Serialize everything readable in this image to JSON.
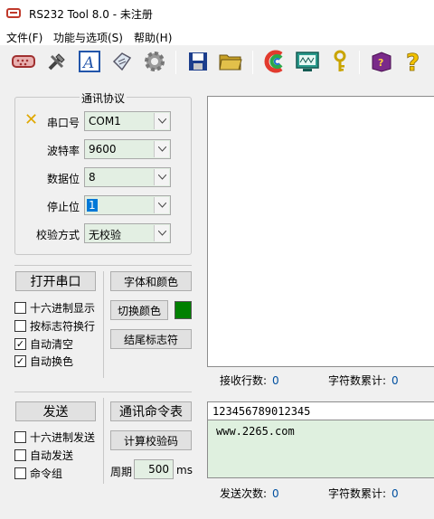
{
  "window": {
    "title": "RS232 Tool 8.0 - 未注册"
  },
  "menu": {
    "items": [
      "文件(F)",
      "功能与选项(S)",
      "帮助(H)"
    ]
  },
  "toolbar": {
    "icons": [
      "serial-port-icon",
      "tools-icon",
      "text-font-icon",
      "tag-icon",
      "gear-icon",
      "save-icon",
      "open-folder-icon",
      "color-icon",
      "monitor-icon",
      "key-icon",
      "book-icon",
      "help-icon"
    ]
  },
  "comm_settings": {
    "title": "通讯协议",
    "port": {
      "label": "串口号",
      "value": "COM1"
    },
    "baud": {
      "label": "波特率",
      "value": "9600"
    },
    "data_bits": {
      "label": "数据位",
      "value": "8"
    },
    "stop_bits": {
      "label": "停止位",
      "value": "1"
    },
    "parity": {
      "label": "校验方式",
      "value": "无校验"
    }
  },
  "receive_controls": {
    "open_port": "打开串口",
    "font_color": "字体和颜色",
    "switch_color": "切换颜色",
    "end_marker": "结尾标志符",
    "accent_color": "#008000",
    "hex_display": {
      "label": "十六进制显示",
      "checked": false
    },
    "wrap_by_marker": {
      "label": "按标志符换行",
      "checked": false
    },
    "auto_clear": {
      "label": "自动清空",
      "checked": true
    },
    "auto_color": {
      "label": "自动换色",
      "checked": true
    }
  },
  "receive_stats": {
    "rows_label": "接收行数:",
    "rows_value": "0",
    "chars_label": "字符数累计:",
    "chars_value": "0"
  },
  "send_controls": {
    "send": "发送",
    "cmd_table": "通讯命令表",
    "calc_checksum": "计算校验码",
    "hex_send": {
      "label": "十六进制发送",
      "checked": false
    },
    "auto_send": {
      "label": "自动发送",
      "checked": false
    },
    "cmd_group": {
      "label": "命令组",
      "checked": false
    },
    "period_label": "周期",
    "period_value": "500",
    "period_unit": "ms"
  },
  "send_area": {
    "input_value": "123456789012345",
    "text": "www.2265.com"
  },
  "send_stats": {
    "count_label": "发送次数:",
    "count_value": "0",
    "chars_label": "字符数累计:",
    "chars_value": "0"
  }
}
